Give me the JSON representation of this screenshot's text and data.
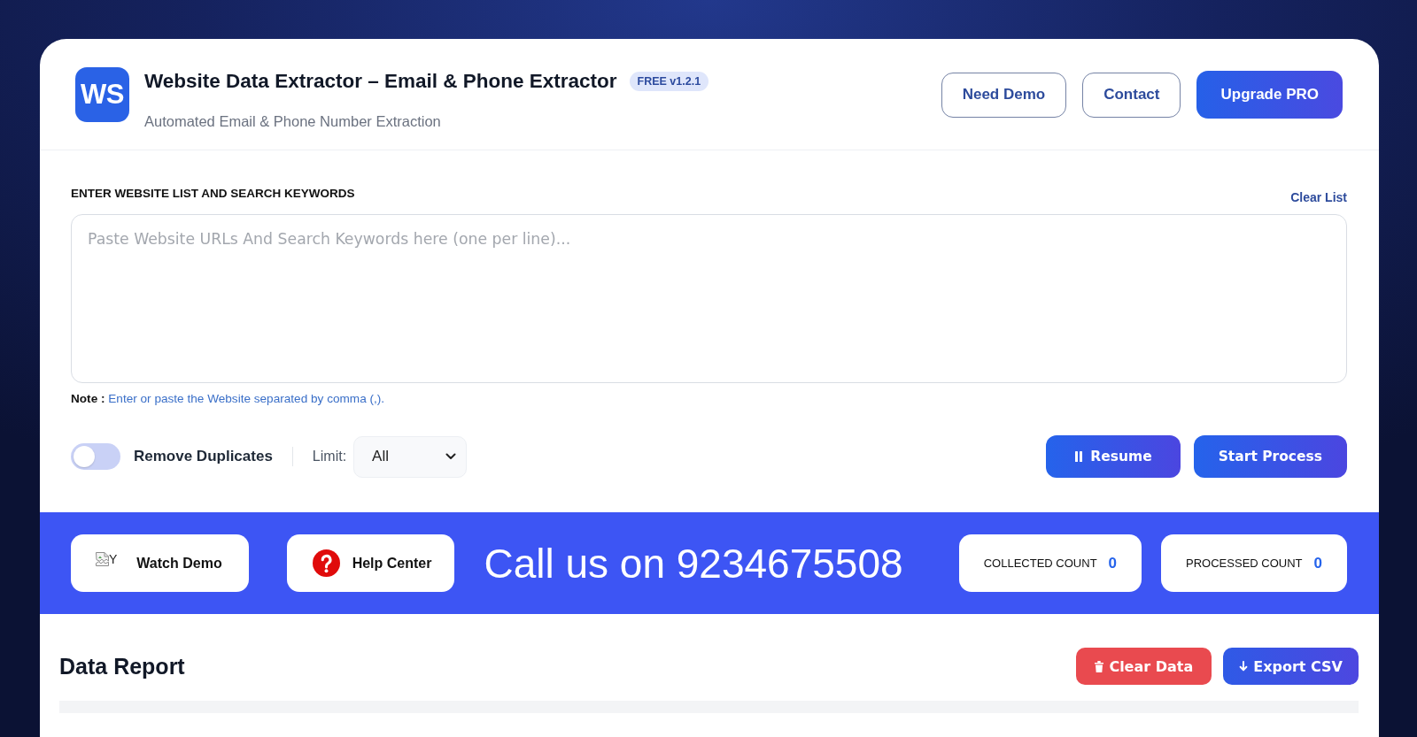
{
  "header": {
    "logo_text": "WS",
    "title": "Website Data Extractor – Email & Phone Extractor",
    "badge": "FREE v1.2.1",
    "subtitle": "Automated Email & Phone Number Extraction",
    "buttons": [
      {
        "label": "Need Demo",
        "kind": "outline"
      },
      {
        "label": "Contact",
        "kind": "outline"
      },
      {
        "label": "Upgrade PRO",
        "kind": "primary"
      }
    ]
  },
  "input_section": {
    "label": "ENTER WEBSITE LIST AND SEARCH KEYWORDS",
    "clear_link": "Clear List",
    "textarea": {
      "placeholder": "Paste Website URLs And Search Keywords here (one per line)..."
    },
    "note": "**Note :** Enter or paste the Website separated by comma (,)."
  },
  "controls": {
    "toggle": {
      "label": "Remove Duplicates",
      "on": false
    },
    "limit": {
      "label": "Limit:",
      "value": "All"
    },
    "buttons": [
      {
        "label": "Resume",
        "kind": "pause"
      },
      {
        "label": "Start Process",
        "kind": "plain"
      }
    ]
  },
  "banner": {
    "links": [
      {
        "label": "Watch Demo",
        "kind": "broken-image",
        "alt_text": "Y"
      },
      {
        "label": "Help Center",
        "kind": "help"
      }
    ],
    "call_text": "Call us on 9234675508",
    "counters": [
      {
        "label": "COLLECTED COUNT",
        "value": "0"
      },
      {
        "label": "PROCESSED COUNT",
        "value": "0"
      }
    ]
  },
  "report": {
    "title": "Data Report",
    "buttons": [
      {
        "label": "Clear Data",
        "kind": "danger"
      },
      {
        "label": "Export CSV",
        "kind": "export"
      }
    ]
  }
}
